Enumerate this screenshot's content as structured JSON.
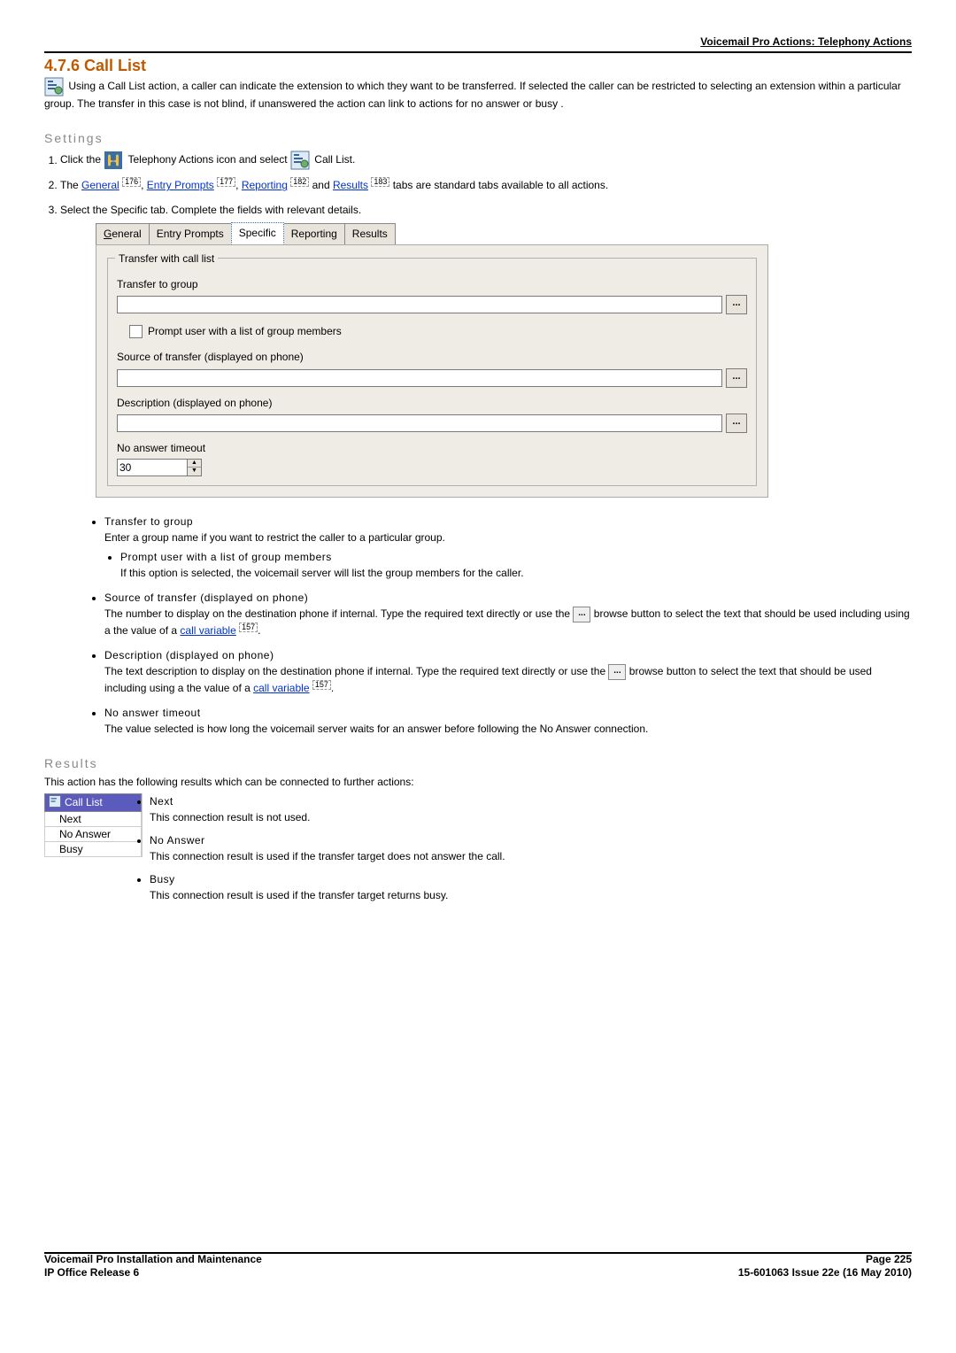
{
  "header": {
    "breadcrumb": "Voicemail Pro Actions: Telephony Actions"
  },
  "title": "4.7.6 Call List",
  "intro_part1": " Using a Call List action, a caller can indicate the extension to which they want to be transferred. If selected the caller can be restricted to selecting an extension within a particular group. The transfer in this case is not blind, if unanswered the action can link to actions for no answer or busy .",
  "settings": {
    "heading": "Settings",
    "step1_a": "Click the ",
    "step1_b": " Telephony Actions icon and select ",
    "step1_c": " Call List.",
    "step2_a": "The ",
    "step2_general": "General",
    "step2_general_pg": "176",
    "step2_comma1": ", ",
    "step2_ep": "Entry Prompts",
    "step2_ep_pg": "177",
    "step2_comma2": ", ",
    "step2_rep": "Reporting",
    "step2_rep_pg": "182",
    "step2_and": " and ",
    "step2_res": "Results",
    "step2_res_pg": "183",
    "step2_tail": " tabs are standard tabs available to all actions.",
    "step3": "Select the Specific tab. Complete the fields with relevant details."
  },
  "tabs": {
    "general": "General",
    "general_mn": "G",
    "entry": "Entry Prompts",
    "specific": "Specific",
    "reporting": "Reporting",
    "results": "Results"
  },
  "panel": {
    "legend": "Transfer with call list",
    "transfer_to_group": "Transfer to group",
    "prompt_user": "Prompt user with a list of group members",
    "source_label": "Source of transfer (displayed on phone)",
    "desc_label": "Description (displayed on phone)",
    "timeout_label": "No answer timeout",
    "timeout_value": "30",
    "browse": "..."
  },
  "bullets": {
    "b1_title": "Transfer to group",
    "b1_body": "Enter a group name if you want to restrict the caller to a particular group.",
    "b1a_title": "Prompt user with a list of group members",
    "b1a_body": "If this option is selected, the voicemail server will list the group members for the caller.",
    "b2_title": "Source of transfer (displayed on phone)",
    "b2_body_a": "The number to display on the destination phone if internal. Type the required text directly or use the ",
    "b2_body_b": " browse button to select the text that should be used including using a the value of a ",
    "b2_link": "call variable",
    "b2_pg": "157",
    "b2_tail": ".",
    "b3_title": "Description (displayed on phone)",
    "b3_body_a": "The text description to display on the destination phone if internal. Type the required text directly or use the ",
    "b3_body_b": " browse button to select the text that should be used including using a the value of a ",
    "b3_link": "call variable",
    "b3_pg": "157",
    "b3_tail": ".",
    "b4_title": "No answer timeout",
    "b4_body": "The value selected is how long the voicemail server waits for an answer before following the No Answer connection."
  },
  "results": {
    "heading": "Results",
    "intro": "This action has the following results which can be connected to further actions:",
    "tree_header": "Call List",
    "tree_next": "Next",
    "tree_noanswer": "No Answer",
    "tree_busy": "Busy",
    "r1_title": "Next",
    "r1_body": "This connection result is not used.",
    "r2_title": "No Answer",
    "r2_body": "This connection result is used if the transfer target does not answer the call.",
    "r3_title": "Busy",
    "r3_body": "This connection result is used if the transfer target returns busy."
  },
  "footer": {
    "left1": "Voicemail Pro Installation and Maintenance",
    "left2": "IP Office Release 6",
    "right1": "Page 225",
    "right2": "15-601063 Issue 22e (16 May 2010)"
  }
}
